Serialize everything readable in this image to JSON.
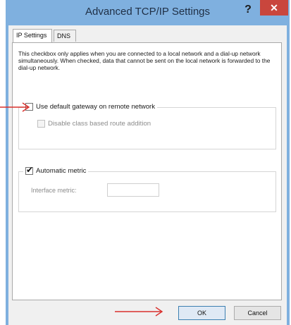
{
  "window": {
    "title": "Advanced TCP/IP Settings",
    "help_glyph": "?",
    "close_glyph": "✕"
  },
  "tabs": [
    {
      "label": "IP Settings",
      "active": true
    },
    {
      "label": "DNS",
      "active": false
    }
  ],
  "ip_settings": {
    "description": "This checkbox only applies when you are connected to a local network and a dial-up network simultaneously. When checked, data that cannot be sent on the local network is forwarded to the dial-up network.",
    "use_default_gateway": {
      "label": "Use default gateway on remote network",
      "checked": false
    },
    "disable_class_route": {
      "label": "Disable class based route addition",
      "checked": false,
      "enabled": false
    },
    "automatic_metric": {
      "label": "Automatic metric",
      "checked": true
    },
    "interface_metric": {
      "label": "Interface metric:",
      "value": ""
    }
  },
  "buttons": {
    "ok": "OK",
    "cancel": "Cancel"
  },
  "colors": {
    "annotation_arrow": "#d9302c",
    "title_bar": "#7fb0df",
    "close_button": "#c9463d"
  },
  "icons": [
    "help-icon",
    "close-icon",
    "checkmark-icon",
    "red-arrow-annotation"
  ]
}
